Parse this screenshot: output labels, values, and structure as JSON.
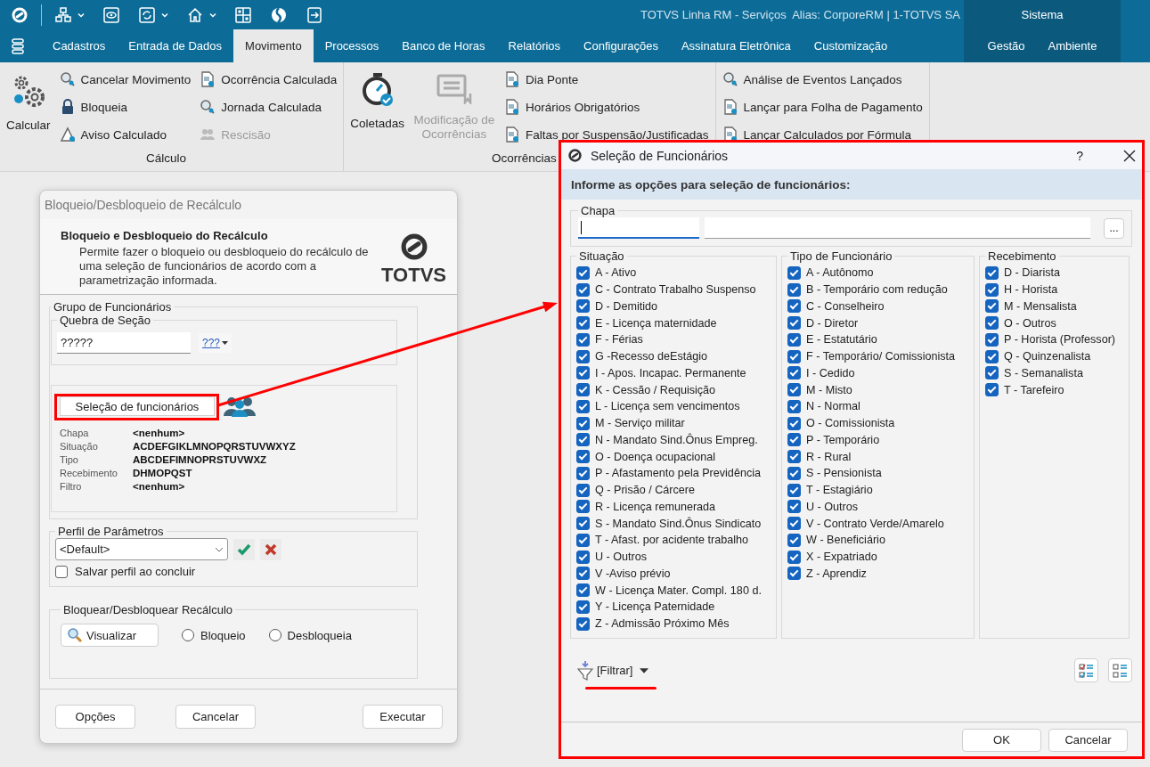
{
  "app": {
    "title": "TOTVS Linha RM - Serviços  Alias: CorporeRM | 1-TOTVS SA"
  },
  "menu_tabs": [
    {
      "label": "Cadastros",
      "selected": false
    },
    {
      "label": "Entrada de Dados",
      "selected": false
    },
    {
      "label": "Movimento",
      "selected": true
    },
    {
      "label": "Processos",
      "selected": false
    },
    {
      "label": "Banco de Horas",
      "selected": false
    },
    {
      "label": "Relatórios",
      "selected": false
    },
    {
      "label": "Configurações",
      "selected": false
    },
    {
      "label": "Assinatura Eletrônica",
      "selected": false
    },
    {
      "label": "Customização",
      "selected": false
    }
  ],
  "system": {
    "label": "Sistema",
    "tabs": [
      {
        "label": "Gestão",
        "selected": false
      },
      {
        "label": "Ambiente",
        "selected": false
      }
    ]
  },
  "ribbon": {
    "groups": [
      {
        "label": "Cálculo",
        "columns": [
          [
            {
              "label": "Calcular",
              "kind": "large",
              "disabled": false
            }
          ],
          [
            {
              "label": "Cancelar Movimento",
              "kind": "small",
              "disabled": false
            },
            {
              "label": "Bloqueia",
              "kind": "small",
              "disabled": false
            },
            {
              "label": "Aviso Calculado",
              "kind": "small",
              "disabled": false
            }
          ],
          [
            {
              "label": "Ocorrência Calculada",
              "kind": "small",
              "disabled": false
            },
            {
              "label": "Jornada Calculada",
              "kind": "small",
              "disabled": false
            },
            {
              "label": "Rescisão",
              "kind": "small",
              "disabled": true
            }
          ]
        ]
      },
      {
        "label": "Ocorrências",
        "columns": [
          [
            {
              "label": "Coletadas",
              "kind": "large",
              "disabled": false
            }
          ],
          [
            {
              "label": "Modificação de Ocorrências",
              "kind": "large",
              "disabled": true
            }
          ],
          [
            {
              "label": "Dia Ponte",
              "kind": "small",
              "disabled": false
            },
            {
              "label": "Horários Obrigatórios",
              "kind": "small",
              "disabled": false
            },
            {
              "label": "Faltas por Suspensão/Justificadas",
              "kind": "small",
              "disabled": false
            }
          ]
        ]
      },
      {
        "columns": [
          [
            {
              "label": "Análise de Eventos Lançados",
              "kind": "small",
              "disabled": false
            },
            {
              "label": "Lançar para Folha de Pagamento",
              "kind": "small",
              "disabled": false
            },
            {
              "label": "Lançar Calculados por Fórmula",
              "kind": "small",
              "disabled": false
            }
          ]
        ]
      }
    ]
  },
  "recalc_dialog": {
    "title": "Bloqueio/Desbloqueio de Recálculo",
    "heading": "Bloqueio e Desbloqueio do Recálculo",
    "description": "Permite fazer o bloqueio ou desbloqueio do recálculo de uma seleção de funcionários de acordo com a parametrização informada.",
    "logo_text": "TOTVS",
    "employee_group": {
      "label": "Grupo de Funcionários",
      "section_break": {
        "label": "Quebra de Seção",
        "value": "?????",
        "mask_button": "???"
      },
      "selection_button": "Seleção de funcionários",
      "summary": [
        {
          "label": "Chapa",
          "value": "<nenhum>"
        },
        {
          "label": "Situação",
          "value": "ACDEFGIKLMNOPQRSTUVWXYZ"
        },
        {
          "label": "Tipo",
          "value": "ABCDEFIMNOPRSTUVWXZ"
        },
        {
          "label": "Recebimento",
          "value": "DHMOPQST"
        },
        {
          "label": "Filtro",
          "value": "<nenhum>"
        }
      ]
    },
    "profile": {
      "label": "Perfil de Parâmetros",
      "value": "<Default>",
      "save_checkbox": {
        "label": "Salvar perfil ao concluir",
        "checked": false
      }
    },
    "action": {
      "label": "Bloquear/Desbloquear Recálculo",
      "preview_button": "Visualizar",
      "options": [
        {
          "label": "Bloqueio",
          "selected": false
        },
        {
          "label": "Desbloqueia",
          "selected": false
        }
      ]
    },
    "buttons": [
      "Opções",
      "Cancelar",
      "Executar"
    ]
  },
  "selection_dialog": {
    "title": "Seleção de Funcionários",
    "help": "?",
    "banner": "Informe as opções para seleção de funcionários:",
    "chapa": {
      "label": "Chapa",
      "code_focused": true,
      "browse_button": "..."
    },
    "groups": [
      {
        "label": "Situação",
        "options": [
          {
            "label": "A - Ativo",
            "checked": true
          },
          {
            "label": "C - Contrato Trabalho Suspenso",
            "checked": true
          },
          {
            "label": "D - Demitido",
            "checked": true
          },
          {
            "label": "E - Licença maternidade",
            "checked": true
          },
          {
            "label": "F - Férias",
            "checked": true
          },
          {
            "label": "G -Recesso deEstágio",
            "checked": true
          },
          {
            "label": "I - Apos. Incapac. Permanente",
            "checked": true
          },
          {
            "label": "K - Cessão / Requisição",
            "checked": true
          },
          {
            "label": "L - Licença sem vencimentos",
            "checked": true
          },
          {
            "label": "M - Serviço militar",
            "checked": true
          },
          {
            "label": "N - Mandato Sind.Ônus Empreg.",
            "checked": true
          },
          {
            "label": "O - Doença ocupacional",
            "checked": true
          },
          {
            "label": "P - Afastamento pela Previdência",
            "checked": true
          },
          {
            "label": "Q - Prisão / Cárcere",
            "checked": true
          },
          {
            "label": "R - Licença remunerada",
            "checked": true
          },
          {
            "label": "S - Mandato Sind.Ônus Sindicato",
            "checked": true
          },
          {
            "label": "T - Afast. por acidente trabalho",
            "checked": true
          },
          {
            "label": "U - Outros",
            "checked": true
          },
          {
            "label": "V -Aviso prévio",
            "checked": true
          },
          {
            "label": "W - Licença Mater. Compl. 180 d.",
            "checked": true
          },
          {
            "label": "Y - Licença Paternidade",
            "checked": true
          },
          {
            "label": "Z - Admissão Próximo Mês",
            "checked": true
          }
        ]
      },
      {
        "label": "Tipo de Funcionário",
        "options": [
          {
            "label": "A - Autônomo",
            "checked": true
          },
          {
            "label": "B - Temporário com redução",
            "checked": true
          },
          {
            "label": "C - Conselheiro",
            "checked": true
          },
          {
            "label": "D - Diretor",
            "checked": true
          },
          {
            "label": "E - Estatutário",
            "checked": true
          },
          {
            "label": "F - Temporário/ Comissionista",
            "checked": true
          },
          {
            "label": "I - Cedido",
            "checked": true
          },
          {
            "label": "M - Misto",
            "checked": true
          },
          {
            "label": "N - Normal",
            "checked": true
          },
          {
            "label": "O - Comissionista",
            "checked": true
          },
          {
            "label": "P - Temporário",
            "checked": true
          },
          {
            "label": "R - Rural",
            "checked": true
          },
          {
            "label": "S - Pensionista",
            "checked": true
          },
          {
            "label": "T - Estagiário",
            "checked": true
          },
          {
            "label": "U - Outros",
            "checked": true
          },
          {
            "label": "V - Contrato Verde/Amarelo",
            "checked": true
          },
          {
            "label": "W - Beneficiário",
            "checked": true
          },
          {
            "label": "X - Expatriado",
            "checked": true
          },
          {
            "label": "Z - Aprendiz",
            "checked": true
          }
        ]
      },
      {
        "label": "Recebimento",
        "options": [
          {
            "label": "D - Diarista",
            "checked": true
          },
          {
            "label": "H - Horista",
            "checked": true
          },
          {
            "label": "M - Mensalista",
            "checked": true
          },
          {
            "label": "O - Outros",
            "checked": true
          },
          {
            "label": "P - Horista (Professor)",
            "checked": true
          },
          {
            "label": "Q - Quinzenalista",
            "checked": true
          },
          {
            "label": "S - Semanalista",
            "checked": true
          },
          {
            "label": "T - Tarefeiro",
            "checked": true
          }
        ]
      }
    ],
    "filter": {
      "label": "[Filtrar]"
    },
    "buttons": [
      "OK",
      "Cancelar"
    ]
  }
}
